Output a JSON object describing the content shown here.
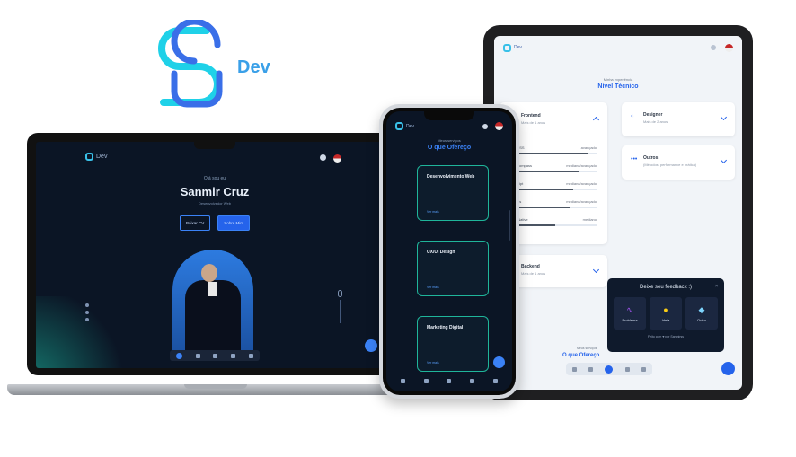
{
  "logo": {
    "text": "Dev",
    "colors": {
      "cyan": "#1fd1e8",
      "blue": "#3a6fe8"
    }
  },
  "laptop": {
    "brand": "Dev",
    "greeting": "Olá sou eu",
    "name": "Sanmir Cruz",
    "role": "Desenvolvedor Web",
    "buttons": {
      "cv": "Baixar CV",
      "about": "Sobre Mim"
    },
    "dock_icons": [
      "home-icon",
      "user-icon",
      "file-icon",
      "briefcase-icon",
      "message-icon"
    ]
  },
  "phone": {
    "brand": "Dev",
    "subtitle": "Meus serviços",
    "title": "O que Ofereço",
    "services": [
      {
        "title": "Desenvolvimento Web",
        "more": "Ver mais"
      },
      {
        "title": "UX/UI Design",
        "more": "Ver mais"
      },
      {
        "title": "Marketing Digital",
        "more": "Ver mais"
      }
    ]
  },
  "tablet": {
    "brand": "Dev",
    "subtitle": "Minha experiência",
    "title": "Nível Técnico",
    "frontend": {
      "title": "Frontend",
      "years": "Mais de 1 anos",
      "skills": [
        {
          "name": "L/CSS",
          "level": "avançado",
          "pct": 0.9
        },
        {
          "name": "s/Compass",
          "level": "mediano/avançado",
          "pct": 0.78
        },
        {
          "name": "Script",
          "level": "mediano/avançado",
          "pct": 0.72
        },
        {
          "name": "ct Js",
          "level": "mediano/avançado",
          "pct": 0.68
        },
        {
          "name": "ct Native",
          "level": "mediano",
          "pct": 0.5
        }
      ]
    },
    "designer": {
      "title": "Designer",
      "years": "Mais de 2 anos"
    },
    "outros": {
      "title": "Outros",
      "years": "(Métodos, performance e prática)"
    },
    "backend": {
      "title": "Backend",
      "years": "Mais de 1 anos"
    },
    "feedback": {
      "title": "Deixe seu feedback :)",
      "close": "×",
      "options": [
        {
          "label": "Problema",
          "icon": "worm-icon"
        },
        {
          "label": "Ideia",
          "icon": "bulb-icon"
        },
        {
          "label": "Outro",
          "icon": "chat-icon"
        }
      ],
      "footer": "Feito com ♥ por Sanmirss"
    },
    "bottom_subtitle": "Meus serviços",
    "bottom_title": "O que Ofereço"
  }
}
